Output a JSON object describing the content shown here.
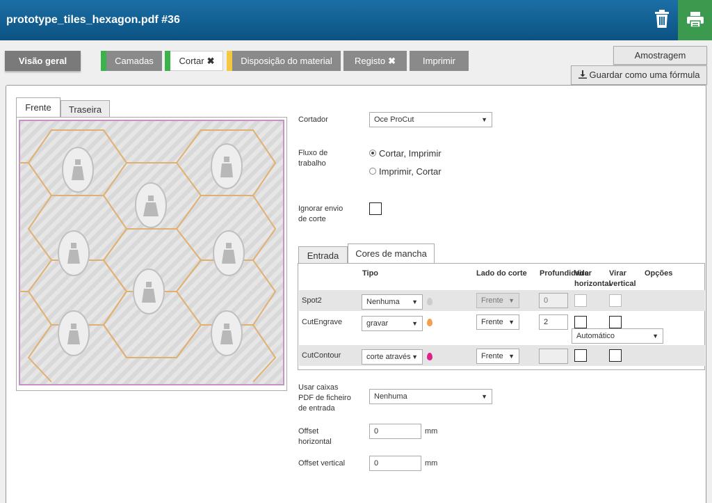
{
  "header": {
    "title": "prototype_tiles_hexagon.pdf #36",
    "brand_color": "#1565a0",
    "print_color": "#3c9a4e"
  },
  "tabs": {
    "overview": "Visão geral",
    "layers": "Camadas",
    "cut": "Cortar",
    "material": "Disposição do material",
    "registration": "Registo",
    "print": "Imprimir"
  },
  "actions": {
    "sampling": "Amostragem",
    "save_formula": "Guardar como uma fórmula"
  },
  "preview": {
    "tab_front": "Frente",
    "tab_back": "Traseira"
  },
  "form": {
    "cutter_label": "Cortador",
    "cutter_value": "Oce ProCut",
    "workflow_label": "Fluxo de trabalho",
    "workflow_opt1": "Cortar, Imprimir",
    "workflow_opt2": "Imprimir, Cortar",
    "ignore_label": "Ignorar envio de corte",
    "pdf_boxes_label": "Usar caixas PDF de ficheiro de entrada",
    "pdf_boxes_value": "Nenhuma",
    "offset_h_label": "Offset horizontal",
    "offset_h_value": "0",
    "offset_v_label": "Offset vertical",
    "offset_v_value": "0",
    "unit": "mm"
  },
  "spot": {
    "tab_input": "Entrada",
    "tab_spot": "Cores de mancha",
    "headers": {
      "type": "Tipo",
      "side": "Lado do corte",
      "depth": "Profundidade",
      "flip_h": "Virar horizontal",
      "flip_v": "Virar vertical",
      "options": "Opções"
    },
    "rows": [
      {
        "name": "Spot2",
        "type": "Nenhuma",
        "side": "Frente",
        "depth": "0",
        "drop": "#cccccc"
      },
      {
        "name": "CutEngrave",
        "type": "gravar",
        "side": "Frente",
        "depth": "2",
        "option": "Automático",
        "drop": "#f0a050"
      },
      {
        "name": "CutContour",
        "type": "corte através",
        "side": "Frente",
        "depth": "",
        "drop": "#e0208a"
      }
    ]
  }
}
